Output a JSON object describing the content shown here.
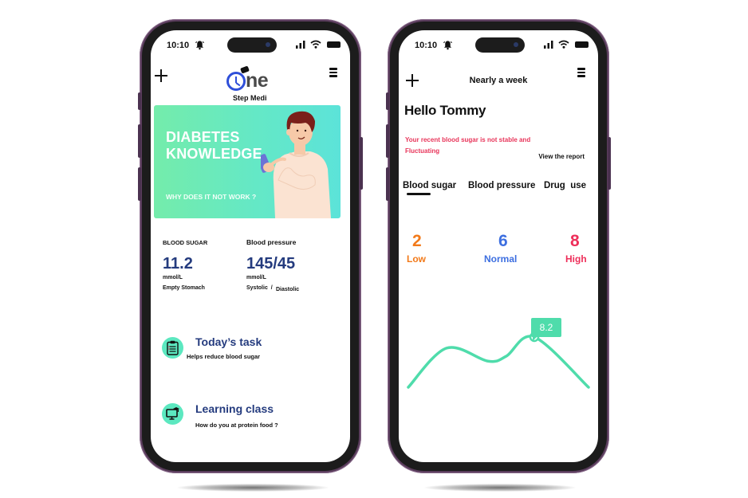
{
  "colors": {
    "brand_blue": "#2f4fd9",
    "navy_text": "#243b7e",
    "mint": "#5ce8c0",
    "chart_line": "#4fdcab",
    "alert_red": "#e8355a",
    "low_orange": "#f27a1a",
    "normal_blue": "#3d6fe0",
    "high_red": "#ee2f5a",
    "frame": "#5a3d5c"
  },
  "left_screen": {
    "status": {
      "time": "10:10",
      "icons": [
        "bell-icon",
        "signal-icon",
        "wifi-icon",
        "battery-icon"
      ]
    },
    "header": {
      "add_icon": "plus-icon",
      "menu_icon": "menu-icon",
      "logo_word": "ne",
      "logo_sub": "Step Medi"
    },
    "banner": {
      "title_line1": "DIABETES",
      "title_line2": "KNOWLEDGE",
      "subtitle": "WHY DOES IT NOT WORK ?"
    },
    "metrics": [
      {
        "label": "BLOOD SUGAR",
        "value": "11.2",
        "unit": "mmol/L",
        "note": "Empty Stomach"
      },
      {
        "label": "Blood pressure",
        "value": "145/45",
        "unit": "mmol/L",
        "note_left": "Systolic  /",
        "note_right": "Diastolic"
      }
    ],
    "cards": [
      {
        "icon": "clipboard-icon",
        "title": "Today’s task",
        "subtitle": "Helps reduce blood sugar"
      },
      {
        "icon": "monitor-graduation-icon",
        "title": "Learning class",
        "subtitle": "How do you at protein food ?"
      }
    ]
  },
  "right_screen": {
    "status": {
      "time": "10:10",
      "icons": [
        "bell-icon",
        "signal-icon",
        "wifi-icon",
        "battery-icon"
      ]
    },
    "header": {
      "add_icon": "plus-icon",
      "title": "Nearly a week",
      "menu_icon": "menu-icon"
    },
    "greeting": "Hello Tommy",
    "alert": "Your recent blood sugar is not stable and Fluctuating",
    "report_link": "View the report",
    "tabs": [
      {
        "label": "Blood sugar",
        "active": true
      },
      {
        "label": "Blood pressure",
        "active": false
      },
      {
        "label": "Drug  use",
        "active": false
      }
    ],
    "stats": [
      {
        "count": "2",
        "label": "Low"
      },
      {
        "count": "6",
        "label": "Normal"
      },
      {
        "count": "8",
        "label": "High"
      }
    ],
    "trend": {
      "highlight_value": "8.2",
      "highlight_index": 4,
      "relative_levels": [
        0.0,
        0.78,
        0.52,
        0.62,
        1.0,
        0.0
      ]
    }
  }
}
